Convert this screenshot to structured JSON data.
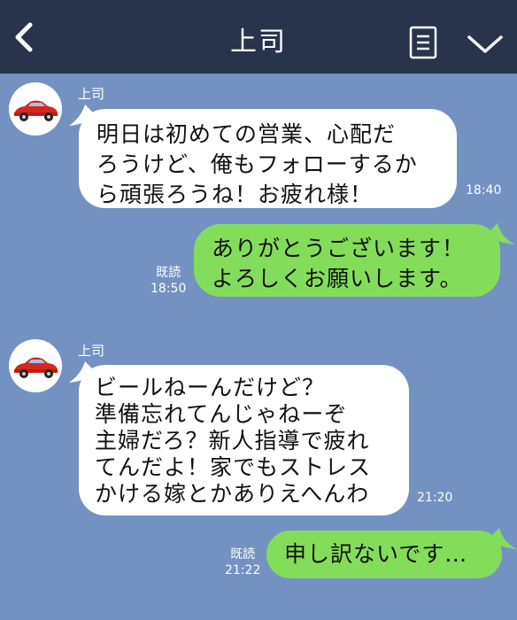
{
  "header": {
    "title": "上司",
    "back_icon": "chevron-left-icon",
    "menu_icon": "note-icon",
    "expand_icon": "chevron-down-icon",
    "background": "#27344b"
  },
  "chat": {
    "background": "#7392c2",
    "incoming_bubble_color": "#ffffff",
    "outgoing_bubble_color": "#84dd5a",
    "messages": [
      {
        "direction": "incoming",
        "sender": "上司",
        "lines": [
          "明日は初めての営業、心配だ",
          "ろうけど、俺もフォローするか",
          "ら頑張ろうね！お疲れ様！"
        ],
        "time": "18:40"
      },
      {
        "direction": "outgoing",
        "read": "既読",
        "lines": [
          "ありがとうございます！",
          "よろしくお願いします。"
        ],
        "time": "18:50"
      },
      {
        "direction": "incoming",
        "sender": "上司",
        "lines": [
          "ビールねーんだけど？",
          "準備忘れてんじゃねーぞ",
          "主婦だろ？新人指導で疲れ",
          "てんだよ！家でもストレス",
          "かける嫁とかありえへんわ"
        ],
        "time": "21:20"
      },
      {
        "direction": "outgoing",
        "read": "既読",
        "lines": [
          "申し訳ないです…"
        ],
        "time": "21:22"
      }
    ]
  }
}
